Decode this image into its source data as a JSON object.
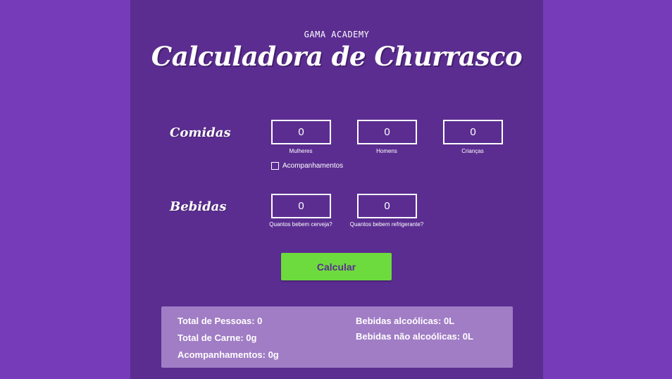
{
  "colors": {
    "page_background": "#763bb9",
    "panel_background": "#5b2d91",
    "button_background": "#6ddb3d",
    "button_text": "#5b2d91",
    "results_background": "#a17dc5"
  },
  "header": {
    "brand": "GAMA ACADEMY",
    "title": "Calculadora de Churrasco"
  },
  "comidas": {
    "label": "Comidas",
    "mulheres": {
      "value": "0",
      "caption": "Mulheres"
    },
    "homens": {
      "value": "0",
      "caption": "Homens"
    },
    "criancas": {
      "value": "0",
      "caption": "Crianças"
    },
    "acompanhamentos": {
      "label": "Acompanhamentos",
      "checked": false
    }
  },
  "bebidas": {
    "label": "Bebidas",
    "cerveja": {
      "value": "0",
      "caption": "Quantos bebem cerveja?"
    },
    "refrigerante": {
      "value": "0",
      "caption": "Quantos bebem refrigerante?"
    }
  },
  "actions": {
    "calcular_label": "Calcular"
  },
  "results": {
    "total_pessoas": "Total de Pessoas: 0",
    "total_carne": "Total de Carne: 0g",
    "acompanhamentos": "Acompanhamentos: 0g",
    "bebidas_alcoolicas": "Bebidas alcoólicas: 0L",
    "bebidas_nao_alcoolicas": "Bebidas não alcoólicas: 0L"
  }
}
